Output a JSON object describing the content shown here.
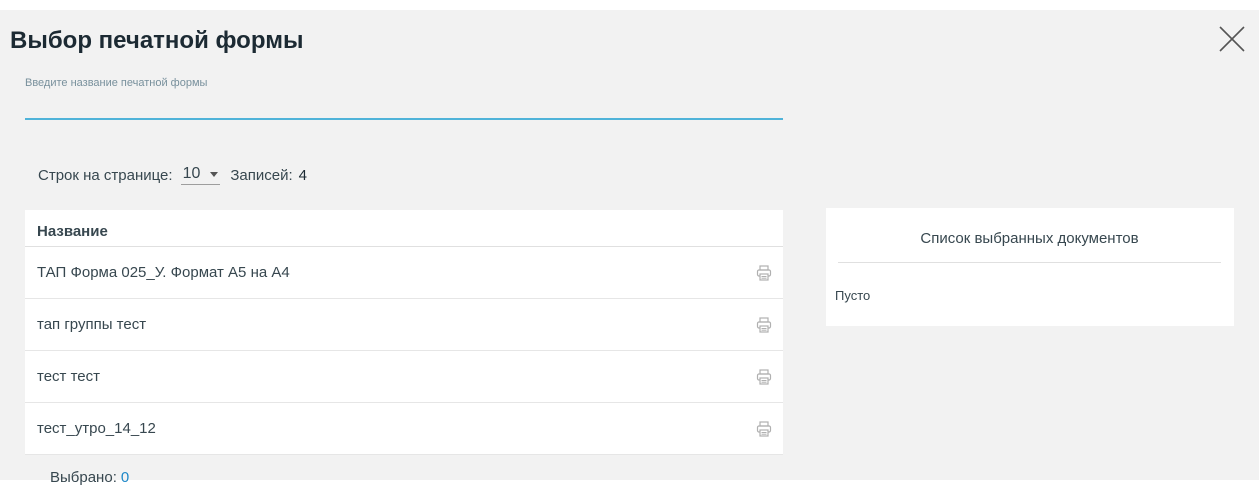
{
  "dialog": {
    "title": "Выбор печатной формы",
    "close_icon": "close-icon"
  },
  "search": {
    "label": "Введите название печатной формы",
    "value": ""
  },
  "pager": {
    "rows_per_page_label": "Строк на странице:",
    "rows_per_page_value": "10",
    "records_label": "Записей:",
    "records_value": "4"
  },
  "table": {
    "header": "Название",
    "rows": [
      {
        "name": "ТАП Форма 025_У. Формат А5 на А4",
        "icon": "printer-icon"
      },
      {
        "name": "тап группы тест",
        "icon": "printer-icon"
      },
      {
        "name": "тест тест",
        "icon": "printer-icon"
      },
      {
        "name": "тест_утро_14_12",
        "icon": "printer-icon"
      }
    ]
  },
  "selection": {
    "label": "Выбрано:",
    "count": "0"
  },
  "documents_panel": {
    "title": "Список выбранных документов",
    "empty_text": "Пусто"
  },
  "colors": {
    "accent": "#4fb3d9",
    "link": "#1e88c8",
    "background": "#f2f2f2"
  }
}
